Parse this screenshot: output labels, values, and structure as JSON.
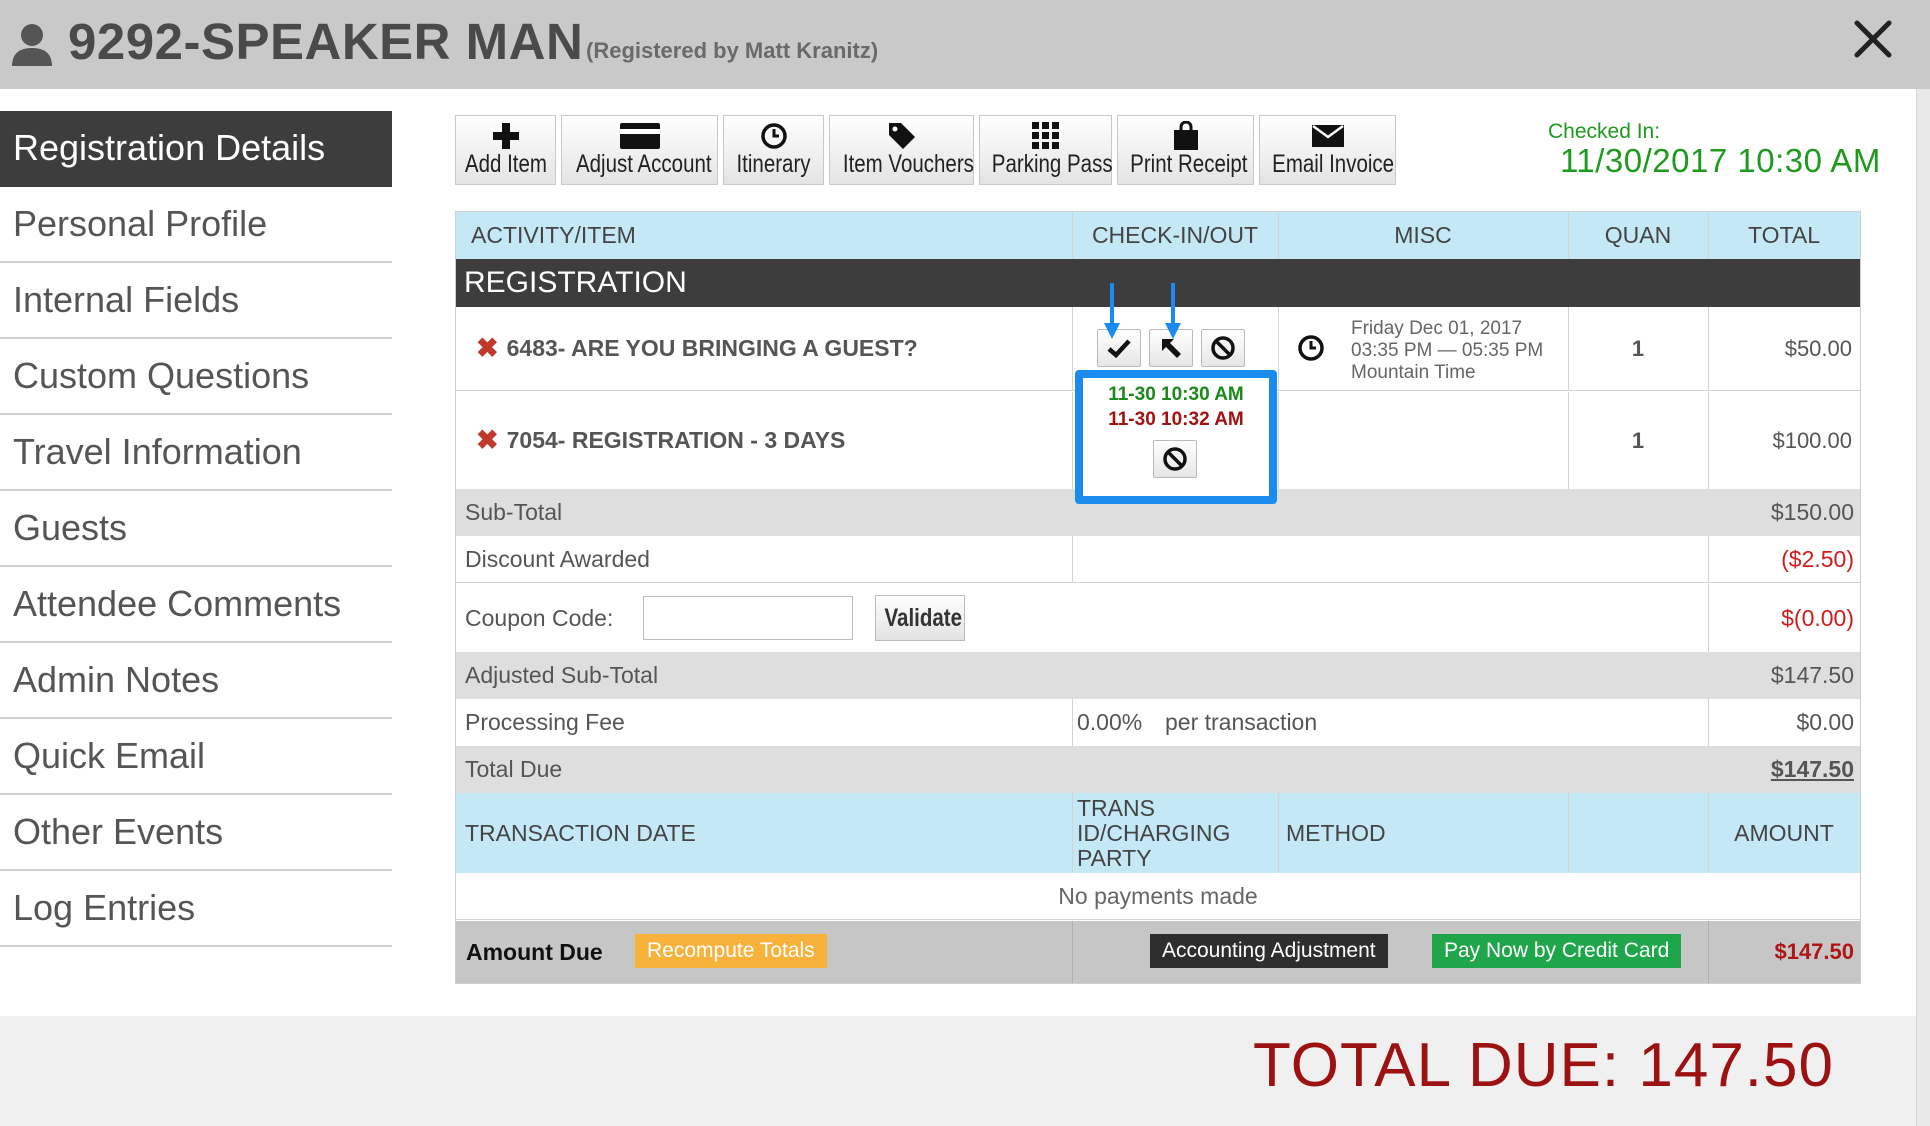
{
  "header": {
    "title": "9292-SPEAKER MAN",
    "subtitle": "(Registered by Matt Kranitz)"
  },
  "sidebar": {
    "items": [
      {
        "label": "Registration Details"
      },
      {
        "label": "Personal Profile"
      },
      {
        "label": "Internal Fields"
      },
      {
        "label": "Custom Questions"
      },
      {
        "label": "Travel Information"
      },
      {
        "label": "Guests"
      },
      {
        "label": "Attendee Comments"
      },
      {
        "label": "Admin Notes"
      },
      {
        "label": "Quick Email"
      },
      {
        "label": "Other Events"
      },
      {
        "label": "Log Entries"
      }
    ]
  },
  "toolbar": {
    "add_item": "Add Item",
    "adjust_account": "Adjust Account",
    "itinerary": "Itinerary",
    "item_vouchers": "Item Vouchers",
    "parking_pass": "Parking Pass",
    "print_receipt": "Print Receipt",
    "email_invoice": "Email Invoice"
  },
  "checked_in": {
    "label": "Checked In:",
    "value": "11/30/2017 10:30 AM"
  },
  "table": {
    "headers": {
      "activity": "ACTIVITY/ITEM",
      "checkinout": "CHECK-IN/OUT",
      "misc": "MISC",
      "quan": "QUAN",
      "total": "TOTAL"
    },
    "section": "REGISTRATION",
    "items": [
      {
        "name": "6483- ARE YOU BRINGING A GUEST?",
        "misc_line1": "Friday Dec 01, 2017",
        "misc_line2": "03:35 PM — 05:35 PM",
        "misc_line3": "Mountain Time",
        "quan": "1",
        "total": "$50.00"
      },
      {
        "name": "7054- REGISTRATION - 3 DAYS",
        "checkin": "11-30 10:30 AM",
        "checkout": "11-30 10:32 AM",
        "quan": "1",
        "total": "$100.00"
      }
    ],
    "subtotal_label": "Sub-Total",
    "subtotal_value": "$150.00",
    "discount_label": "Discount Awarded",
    "discount_value": "($2.50)",
    "coupon_label": "Coupon Code:",
    "coupon_value": "",
    "validate_label": "Validate",
    "coupon_amount": "$(0.00)",
    "adjusted_label": "Adjusted Sub-Total",
    "adjusted_value": "$147.50",
    "fee_label": "Processing Fee",
    "fee_percent": "0.00%",
    "fee_desc": "per transaction",
    "fee_value": "$0.00",
    "total_due_label": "Total Due",
    "total_due_value": "$147.50",
    "trans_headers": {
      "date": "TRANSACTION DATE",
      "trans_id": "TRANS ID/CHARGING PARTY",
      "method": "METHOD",
      "amount": "AMOUNT"
    },
    "no_payments": "No payments made",
    "amount_due_label": "Amount Due",
    "recompute_label": "Recompute Totals",
    "accounting_label": "Accounting Adjustment",
    "pay_label": "Pay Now by Credit Card",
    "amount_due_value": "$147.50"
  },
  "footer": {
    "total_due": "TOTAL DUE: 147.50"
  },
  "colors": {
    "header_bg": "#c9c9c9",
    "table_header_bg": "#c5e8f7",
    "section_bg": "#3d3d3d",
    "checked_in_green": "#1e9a1e",
    "highlight_blue": "#1a8cf0",
    "total_due_red": "#9c1111",
    "recompute_orange": "#f7b23c",
    "pay_green": "#1fa64a"
  }
}
